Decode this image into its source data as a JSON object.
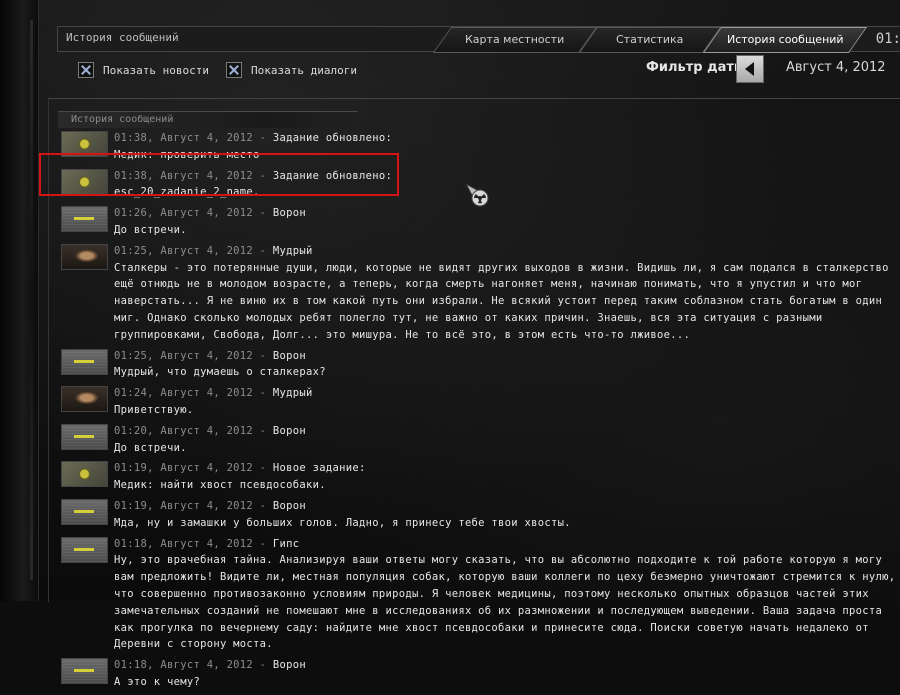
{
  "header": {
    "title": "История сообщений",
    "tabs": [
      {
        "label": "Карта местности",
        "active": false
      },
      {
        "label": "Статистика",
        "active": false
      },
      {
        "label": "История сообщений",
        "active": true
      }
    ],
    "clock": "01:"
  },
  "filters": {
    "show_news": {
      "label": "Показать новости",
      "checked": true
    },
    "show_dialogs": {
      "label": "Показать диалоги",
      "checked": true
    },
    "date_filter_label": "Фильтр даты",
    "date_value": "Август 4, 2012"
  },
  "panel": {
    "title": "История сообщений"
  },
  "messages": [
    {
      "time": "01:38, Август 4, 2012 -",
      "sender": "Задание обновлено:",
      "avatar": "task",
      "text": "Медик: проверить место"
    },
    {
      "time": "01:38, Август 4, 2012 -",
      "sender": "Задание обновлено:",
      "avatar": "task",
      "text": "esc_20_zadanie_2_name."
    },
    {
      "time": "01:26, Август 4, 2012 -",
      "sender": "Ворон",
      "avatar": "voron",
      "text": "До встречи."
    },
    {
      "time": "01:25, Август 4, 2012 -",
      "sender": "Мудрый",
      "avatar": "face",
      "text": "Сталкеры - это потерянные души, люди, которые не видят других выходов в жизни. Видишь ли, я сам подался в сталкерство ещё отнюдь не в молодом возрасте, а теперь, когда смерть нагоняет меня, начинаю понимать, что я упустил и что мог наверстать... Я не виню их в том какой путь они избрали. Не всякий устоит перед таким соблазном стать богатым в один миг. Однако сколько молодых ребят полегло тут, не важно от каких причин. Знаешь, вся эта ситуация с разными группировками, Свобода, Долг... это мишура. Не то всё это, в этом есть что-то лживое..."
    },
    {
      "time": "01:25, Август 4, 2012 -",
      "sender": "Ворон",
      "avatar": "voron",
      "text": "Мудрый, что думаешь о сталкерах?"
    },
    {
      "time": "01:24, Август 4, 2012 -",
      "sender": "Мудрый",
      "avatar": "face",
      "text": "Приветствую."
    },
    {
      "time": "01:20, Август 4, 2012 -",
      "sender": "Ворон",
      "avatar": "voron",
      "text": "До встречи."
    },
    {
      "time": "01:19, Август 4, 2012 -",
      "sender": "Новое задание:",
      "avatar": "task",
      "text": "Медик: найти хвост псевдособаки."
    },
    {
      "time": "01:19, Август 4, 2012 -",
      "sender": "Ворон",
      "avatar": "voron",
      "text": "Мда, ну и замашки у больших голов. Ладно, я принесу тебе твои хвосты."
    },
    {
      "time": "01:18, Август 4, 2012 -",
      "sender": "Гипс",
      "avatar": "voron",
      "text": "Ну, это врачебная тайна. Анализируя ваши ответы могу сказать, что вы абсолютно подходите к той работе которую я могу вам предложить! Видите ли, местная популяция собак, которую ваши коллеги по цеху безмерно уничтожают стремится к нулю, что совершенно противозаконно условиям природы. Я человек медицины, поэтому несколько опытных образцов частей этих замечательных созданий не помешают мне в исследованиях об их размножении и последующем выведении. Ваша задача проста как прогулка по вечернему саду: найдите мне хвост псевдособаки и принесите сюда. Поиски советую начать недалеко от Деревни с сторону моста."
    },
    {
      "time": "01:18, Август 4, 2012 -",
      "sender": "Ворон",
      "avatar": "voron",
      "text": "А это к чему?"
    }
  ]
}
